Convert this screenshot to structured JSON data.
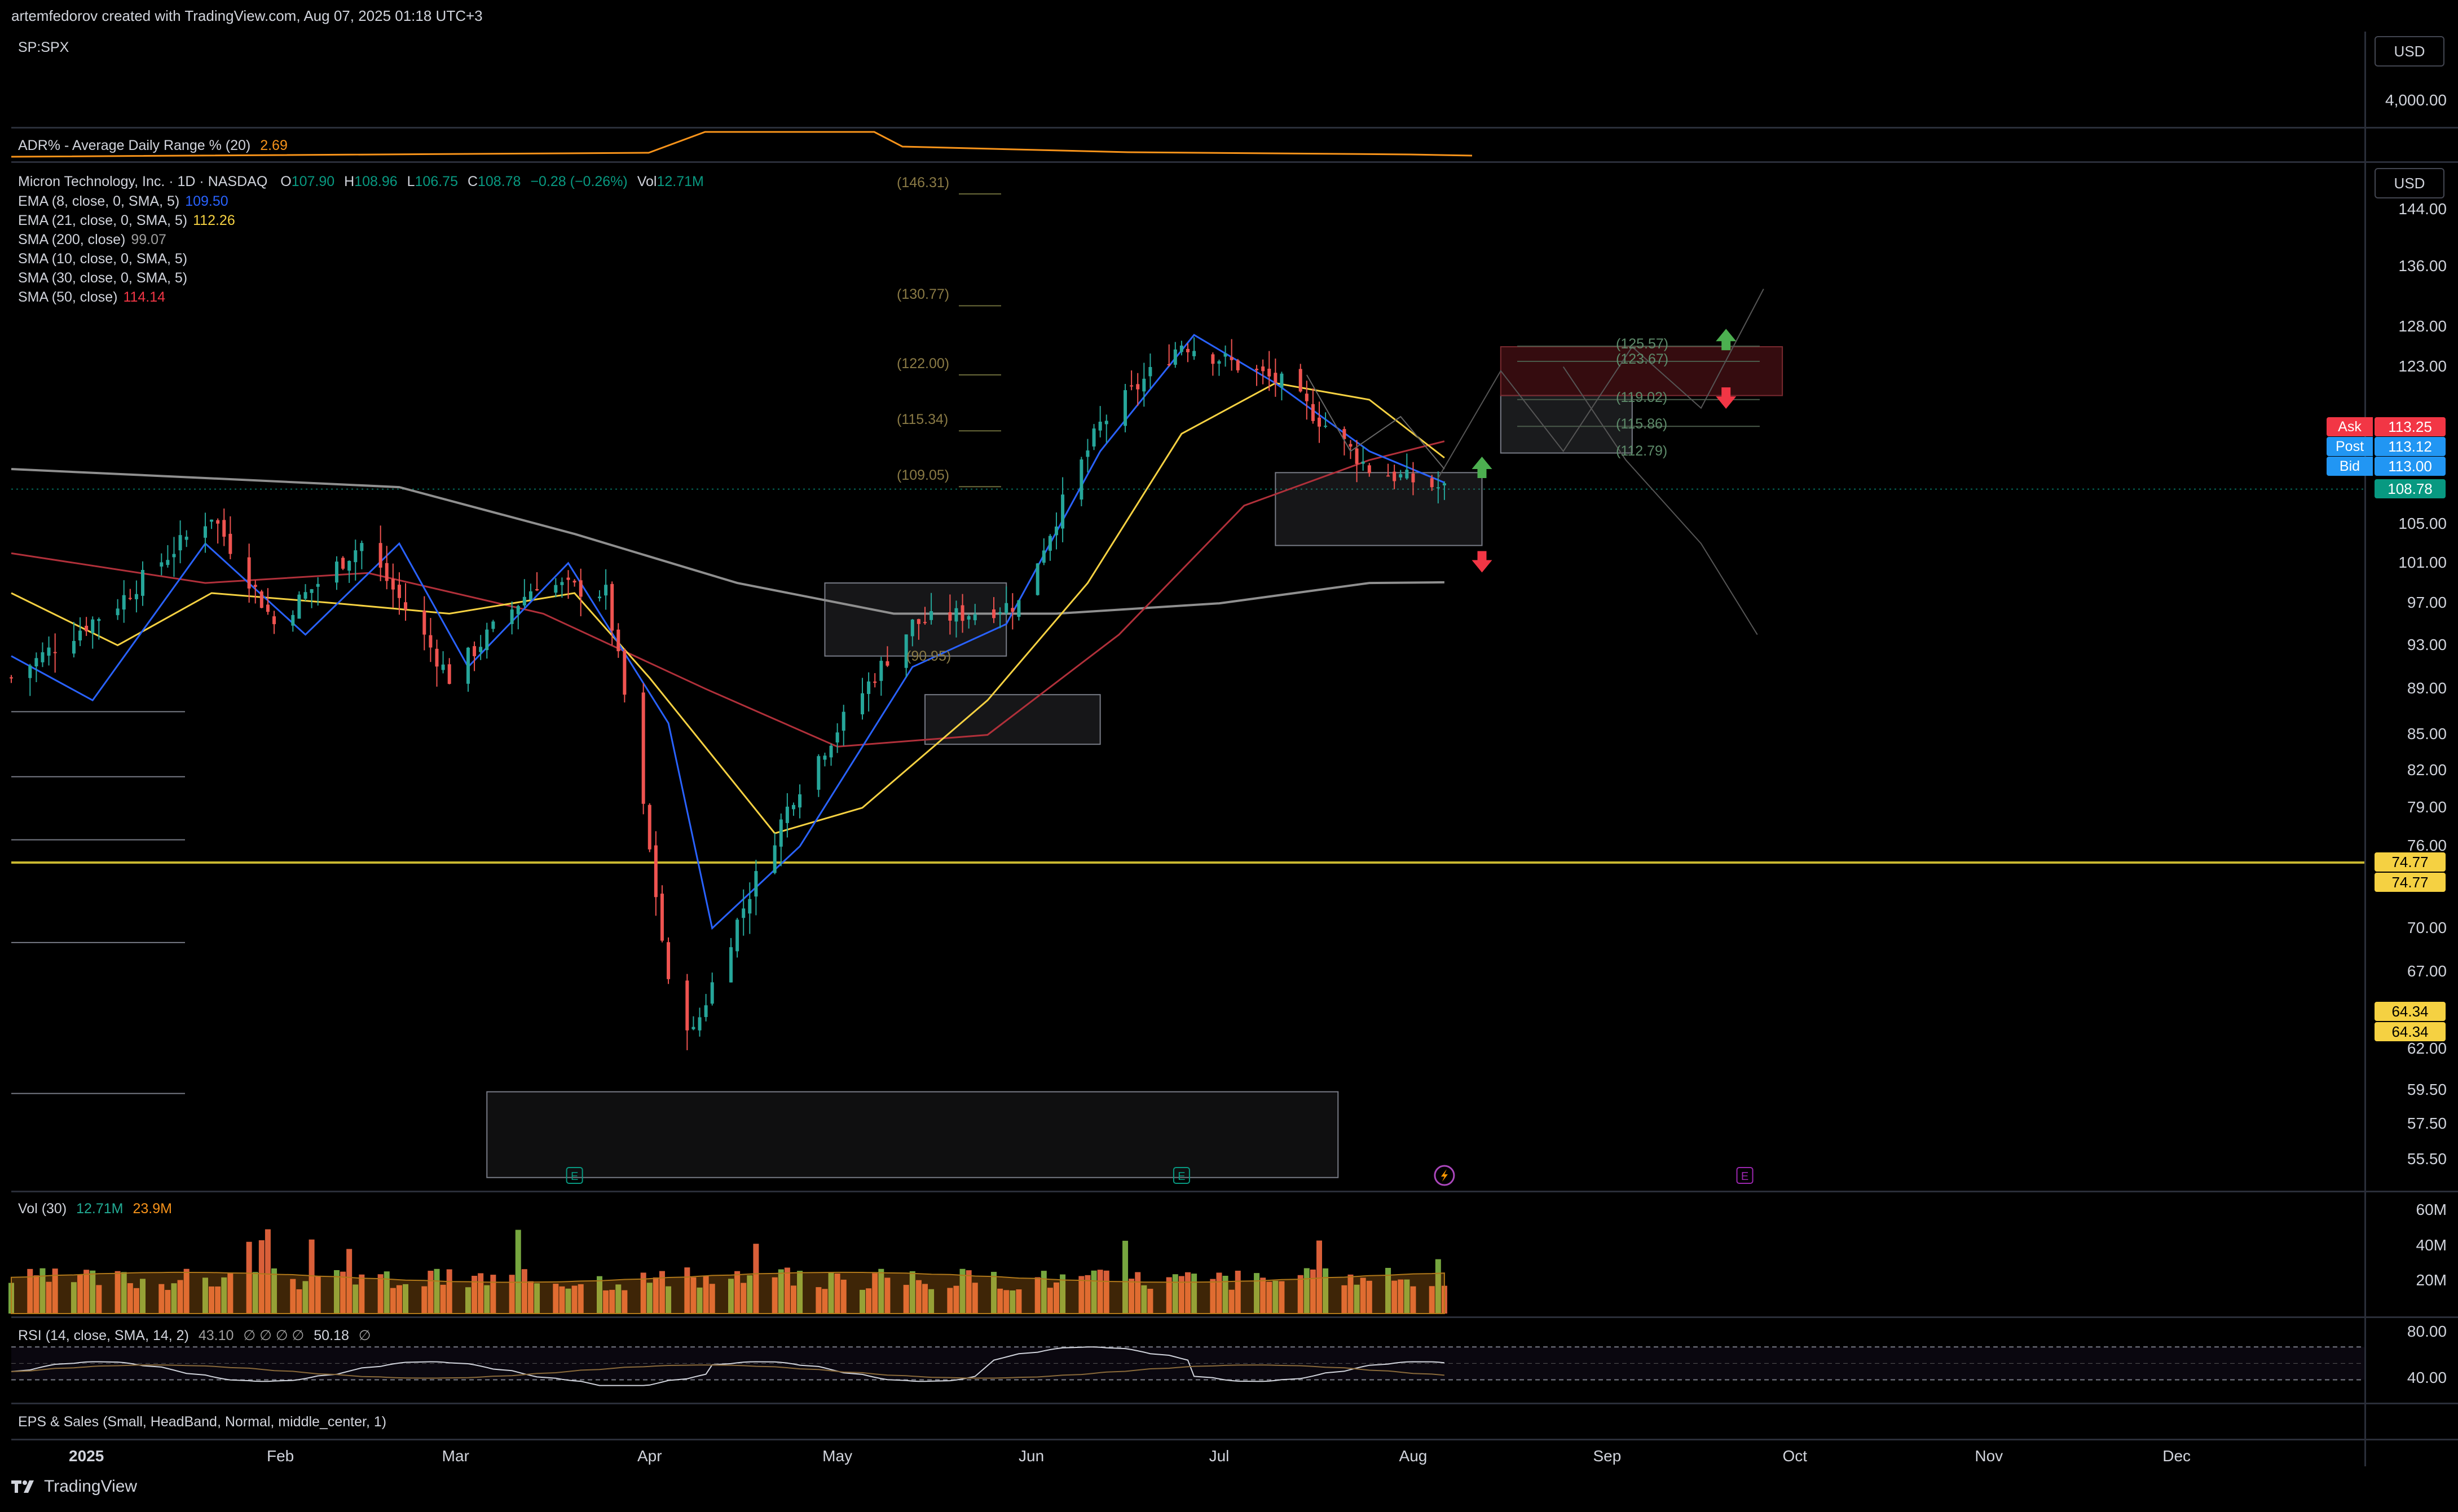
{
  "header": {
    "credit": "artemfedorov created with TradingView.com, Aug 07, 2025 01:18 UTC+3"
  },
  "top_pane": {
    "symbol": "SP:SPX",
    "currency": "USD",
    "scale_label": "4,000.00",
    "adr_label": "ADR% - Average Daily Range % (20)",
    "adr_value": "2.69"
  },
  "main_pane": {
    "currency": "USD",
    "title": "Micron Technology, Inc. · 1D · NASDAQ",
    "ohlc": {
      "o_label": "O",
      "o": "107.90",
      "h_label": "H",
      "h": "108.96",
      "l_label": "L",
      "l": "106.75",
      "c_label": "C",
      "c": "108.78",
      "chg": "−0.28 (−0.26%)",
      "vol_label": "Vol",
      "vol": "12.71M"
    },
    "indicators": [
      {
        "label": "EMA (8, close, 0, SMA, 5)",
        "value": "109.50",
        "color": "#2962ff"
      },
      {
        "label": "EMA (21, close, 0, SMA, 5)",
        "value": "112.26",
        "color": "#f5d142"
      },
      {
        "label": "SMA (200, close)",
        "value": "99.07",
        "color": "#9e9e9e"
      },
      {
        "label": "SMA (10, close, 0, SMA, 5)",
        "value": "",
        "color": "#d1d4dc"
      },
      {
        "label": "SMA (30, close, 0, SMA, 5)",
        "value": "",
        "color": "#d1d4dc"
      },
      {
        "label": "SMA (50, close)",
        "value": "114.14",
        "color": "#f23645"
      }
    ],
    "price_scale": [
      "144.00",
      "136.00",
      "128.00",
      "123.00",
      "105.00",
      "101.00",
      "97.00",
      "93.00",
      "89.00",
      "85.00",
      "82.00",
      "79.00",
      "76.00",
      "70.00",
      "67.00",
      "62.00",
      "59.50",
      "57.50",
      "55.50"
    ],
    "price_tags": [
      {
        "label": "Ask",
        "value": "113.25",
        "color": "#f23645"
      },
      {
        "label": "Post",
        "value": "113.12",
        "color": "#2196f3"
      },
      {
        "label": "Bid",
        "value": "113.00",
        "color": "#2196f3"
      },
      {
        "label": "",
        "value": "108.78",
        "color": "#089981"
      },
      {
        "label": "",
        "value": "74.77",
        "color": "#f5d142"
      },
      {
        "label": "",
        "value": "74.77",
        "color": "#f5d142"
      },
      {
        "label": "",
        "value": "64.34",
        "color": "#f5d142"
      },
      {
        "label": "",
        "value": "64.34",
        "color": "#f5d142"
      }
    ],
    "fib_levels": [
      "(146.31)",
      "(130.77)",
      "(122.00)",
      "(115.34)",
      "(109.05)",
      "(90.95)"
    ],
    "projection_levels": [
      "(125.57)",
      "(123.67)",
      "(119.02)",
      "(115.86)",
      "(112.79)"
    ],
    "earnings_markers": [
      "E",
      "E",
      "E"
    ],
    "event_icon": "lightning-icon"
  },
  "volume_pane": {
    "label": "Vol (30)",
    "value1": "12.71M",
    "value2": "23.9M",
    "scale": [
      "60M",
      "40M",
      "20M"
    ]
  },
  "rsi_pane": {
    "label": "RSI (14, close, SMA, 14, 2)",
    "value1": "43.10",
    "placeholders": "∅ ∅ ∅ ∅",
    "value2": "50.18",
    "trail": "∅",
    "scale": [
      "80.00",
      "40.00"
    ]
  },
  "eps_pane": {
    "label": "EPS & Sales (Small, HeadBand, Normal, middle_center, 1)"
  },
  "time_axis": [
    "2025",
    "Feb",
    "Mar",
    "Apr",
    "May",
    "Jun",
    "Jul",
    "Aug",
    "Sep",
    "Oct",
    "Nov",
    "Dec"
  ],
  "footer": {
    "brand": "TradingView"
  },
  "chart_data": {
    "type": "candlestick",
    "title": "Micron Technology, Inc. · 1D · NASDAQ",
    "ylim": [
      54,
      150
    ],
    "x_range": [
      "2024-12-20",
      "2025-12-31"
    ],
    "approx_close_path": [
      [
        "2024-12-20",
        90
      ],
      [
        "2025-01-06",
        97
      ],
      [
        "2025-01-21",
        106
      ],
      [
        "2025-01-31",
        95
      ],
      [
        "2025-02-14",
        103
      ],
      [
        "2025-02-28",
        90
      ],
      [
        "2025-03-14",
        99
      ],
      [
        "2025-03-25",
        98
      ],
      [
        "2025-04-04",
        66
      ],
      [
        "2025-04-08",
        63
      ],
      [
        "2025-04-24",
        80
      ],
      [
        "2025-05-13",
        95
      ],
      [
        "2025-05-30",
        97
      ],
      [
        "2025-06-12",
        116
      ],
      [
        "2025-06-25",
        126
      ],
      [
        "2025-07-11",
        121
      ],
      [
        "2025-07-25",
        111
      ],
      [
        "2025-08-06",
        108.78
      ]
    ],
    "moving_averages": {
      "EMA 8": 109.5,
      "EMA 21": 112.26,
      "SMA 200": 99.07,
      "SMA 50": 114.14
    },
    "horizontal_line": 74.77,
    "volume_scale_max": "60M",
    "rsi_bands": [
      40,
      80
    ]
  }
}
